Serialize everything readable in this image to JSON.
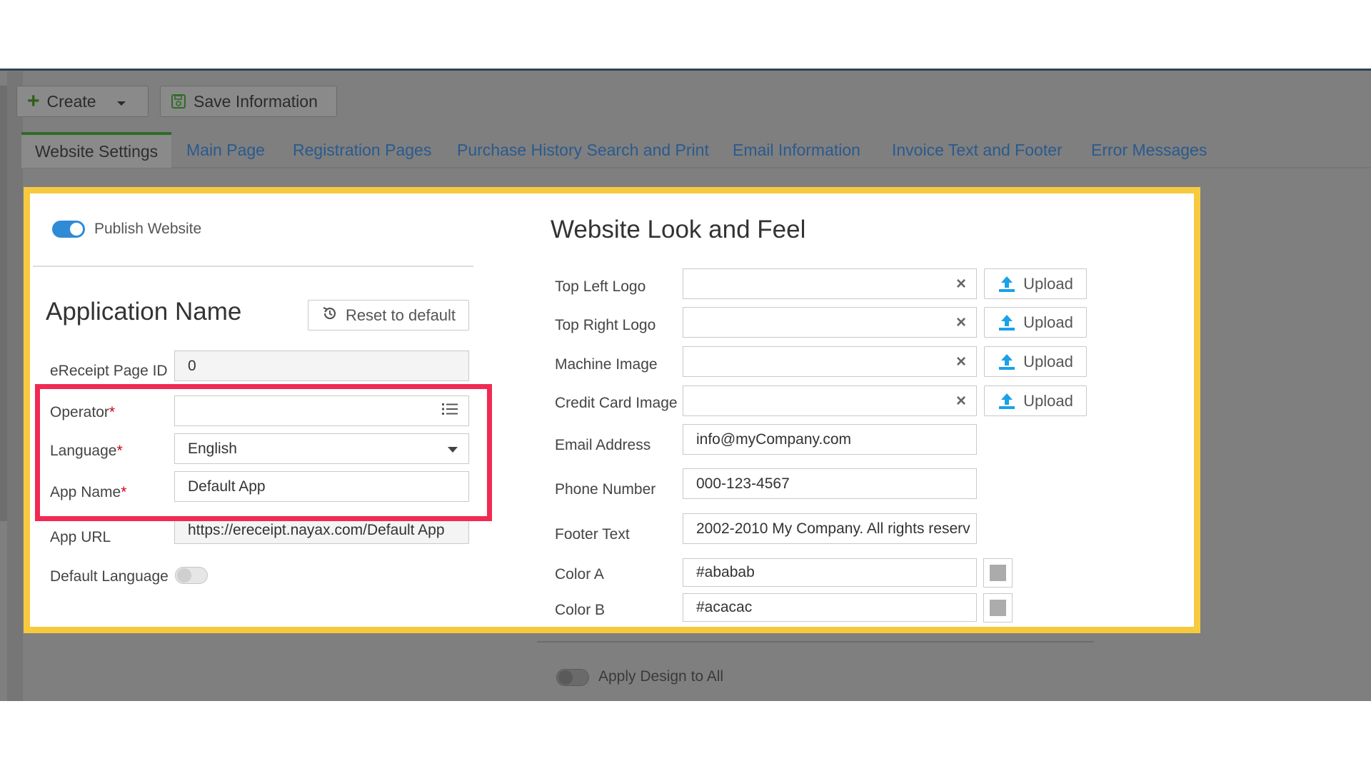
{
  "toolbar": {
    "create_label": "Create",
    "save_label": "Save Information"
  },
  "tabs": [
    {
      "label": "Website Settings",
      "active": true
    },
    {
      "label": "Main Page"
    },
    {
      "label": "Registration Pages"
    },
    {
      "label": "Purchase History Search and Print"
    },
    {
      "label": "Email Information"
    },
    {
      "label": "Invoice Text and Footer"
    },
    {
      "label": "Error Messages"
    }
  ],
  "left": {
    "publish_label": "Publish Website",
    "publish_on": true,
    "app_name_heading": "Application Name",
    "reset_label": "Reset to default",
    "page_id_label": "eReceipt Page ID",
    "page_id_value": "0",
    "operator_label": "Operator",
    "operator_value": "",
    "language_label": "Language",
    "language_value": "English",
    "app_name_label": "App Name",
    "app_name_value": "Default App",
    "app_url_label": "App URL",
    "app_url_value": "https://ereceipt.nayax.com/Default App",
    "default_language_label": "Default Language",
    "default_language_on": false,
    "required_mark": "*"
  },
  "right": {
    "heading": "Website Look and Feel",
    "logo_rows": [
      {
        "label": "Top Left Logo",
        "upload": "Upload"
      },
      {
        "label": "Top Right Logo",
        "upload": "Upload"
      },
      {
        "label": "Machine Image",
        "upload": "Upload"
      },
      {
        "label": "Credit Card Image",
        "upload": "Upload"
      }
    ],
    "email_label": "Email Address",
    "email_value": "info@myCompany.com",
    "phone_label": "Phone Number",
    "phone_value": "000-123-4567",
    "footer_label": "Footer Text",
    "footer_value": "2002-2010 My Company. All rights reserv",
    "color_a_label": "Color A",
    "color_a_value": "#ababab",
    "color_b_label": "Color B",
    "color_b_value": "#acacac",
    "apply_label": "Apply Design to All",
    "apply_on": false
  },
  "colors": {
    "highlight_yellow": "#f7c93e",
    "highlight_red": "#f02a52",
    "accent_blue": "#2f8bd6",
    "tab_link": "#2a5a8e",
    "active_tab_border": "#2f6b28"
  },
  "icons": {
    "create": "plus-icon",
    "create_dropdown": "caret-down-icon",
    "save": "save-disk-icon",
    "reset": "history-icon",
    "operator_list": "list-icon",
    "language_dropdown": "caret-down-icon",
    "clear": "close-icon",
    "upload": "upload-icon"
  }
}
